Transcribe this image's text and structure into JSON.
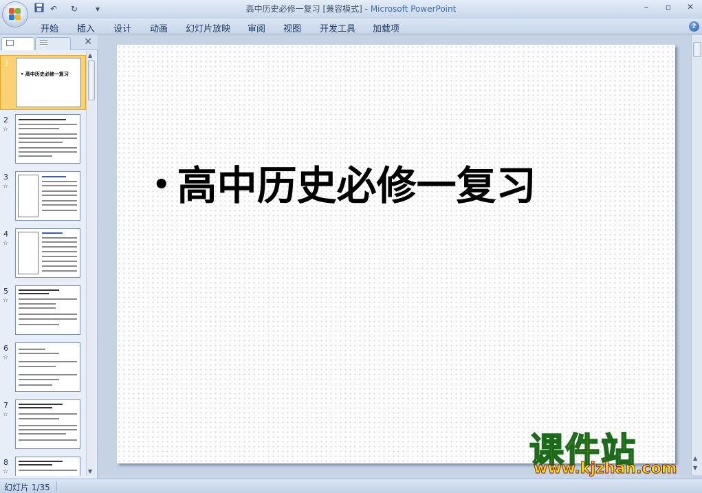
{
  "window": {
    "title": "高中历史必修一复习 [兼容模式]",
    "app_name": "Microsoft PowerPoint",
    "separator": " - "
  },
  "quick_access": {
    "undo_glyph": "↶",
    "redo_glyph": "↻",
    "dropdown_glyph": "▾"
  },
  "window_buttons": {
    "minimize": "–",
    "restore": "▫",
    "close": "✕"
  },
  "ribbon": {
    "tabs": [
      "开始",
      "插入",
      "设计",
      "动画",
      "幻灯片放映",
      "审阅",
      "视图",
      "开发工具",
      "加载项"
    ],
    "help": "?"
  },
  "slides_pane": {
    "close": "✕",
    "thumbnails": [
      {
        "num": "1",
        "title": "• 高中历史必修一复习",
        "selected": true
      },
      {
        "num": "2",
        "star": "☆"
      },
      {
        "num": "3",
        "star": "☆"
      },
      {
        "num": "4",
        "star": "☆"
      },
      {
        "num": "5",
        "star": "☆"
      },
      {
        "num": "6",
        "star": "☆"
      },
      {
        "num": "7",
        "star": "☆"
      },
      {
        "num": "8",
        "star": "☆"
      }
    ]
  },
  "slide": {
    "bullet": "•",
    "text": "高中历史必修一复习"
  },
  "watermark": {
    "title": "课件站",
    "url": "www.kjzhan.com"
  },
  "status": {
    "slide_indicator": "幻灯片 1/35"
  },
  "colors": {
    "accent_selected": "#fbd273",
    "ribbon_bg": "#c8d6ea",
    "text_blue": "#1f3a63"
  }
}
